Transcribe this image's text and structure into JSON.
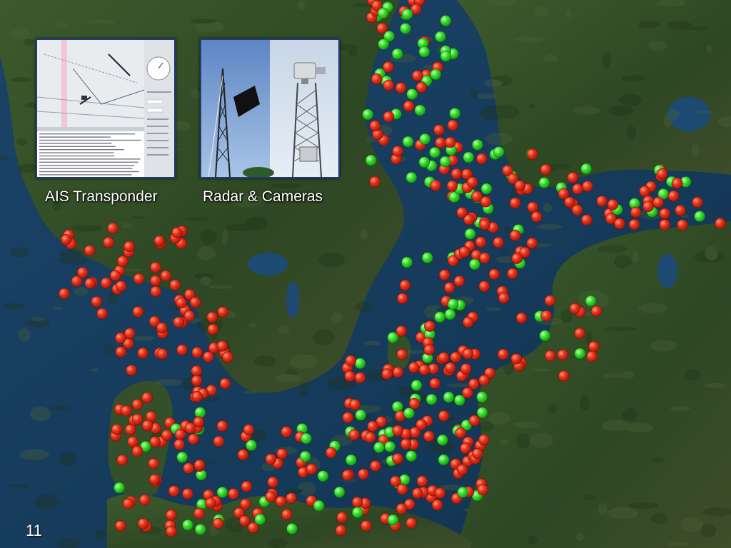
{
  "slide": {
    "page_number": "11",
    "captions": {
      "ais": "AIS Transponder",
      "radar": "Radar & Cameras"
    }
  },
  "map": {
    "colors": {
      "sea": "#1f4f78",
      "sea_deep": "#173e60",
      "land": "#2f4a25",
      "land_dark": "#233a1c",
      "marker_red": "#e8321c",
      "marker_green": "#36e02c"
    },
    "marker_counts": {
      "red": 380,
      "green": 130
    }
  }
}
